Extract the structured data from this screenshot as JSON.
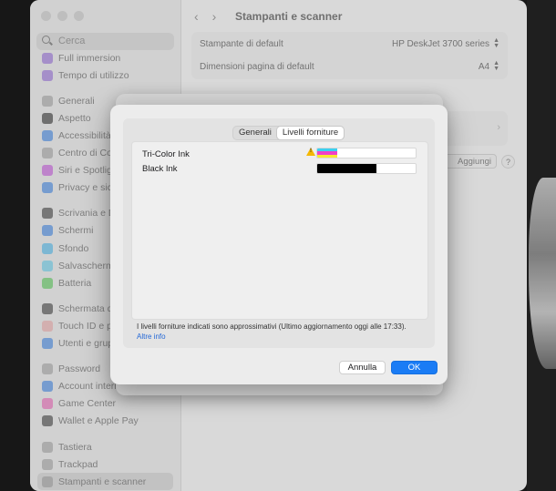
{
  "sidebar": {
    "search_placeholder": "Cerca",
    "items": [
      {
        "label": "Full immersion",
        "icon": "moon-icon",
        "color": "#8e62d6"
      },
      {
        "label": "Tempo di utilizzo",
        "icon": "hourglass-icon",
        "color": "#8e62d6"
      },
      {
        "label": "Generali",
        "icon": "gear-icon",
        "color": "#9a9a9a"
      },
      {
        "label": "Aspetto",
        "icon": "appearance-icon",
        "color": "#222222"
      },
      {
        "label": "Accessibilità",
        "icon": "accessibility-icon",
        "color": "#2f7be0"
      },
      {
        "label": "Centro di Cont",
        "icon": "control-center-icon",
        "color": "#9a9a9a"
      },
      {
        "label": "Siri e Spotlight",
        "icon": "siri-icon",
        "color": "#c04ad8"
      },
      {
        "label": "Privacy e sicur",
        "icon": "hand-icon",
        "color": "#2f7be0"
      },
      {
        "label": "Scrivania e Do",
        "icon": "dock-icon",
        "color": "#333333"
      },
      {
        "label": "Schermi",
        "icon": "display-icon",
        "color": "#2f7be0"
      },
      {
        "label": "Sfondo",
        "icon": "wallpaper-icon",
        "color": "#3eb0e8"
      },
      {
        "label": "Salvaschermo",
        "icon": "screensaver-icon",
        "color": "#5ac8e8"
      },
      {
        "label": "Batteria",
        "icon": "battery-icon",
        "color": "#4cc44c"
      },
      {
        "label": "Schermata di b",
        "icon": "lock-icon",
        "color": "#333333"
      },
      {
        "label": "Touch ID e pas",
        "icon": "fingerprint-icon",
        "color": "#e8a0a0"
      },
      {
        "label": "Utenti e grupp",
        "icon": "users-icon",
        "color": "#2f7be0"
      },
      {
        "label": "Password",
        "icon": "key-icon",
        "color": "#9a9a9a"
      },
      {
        "label": "Account intern",
        "icon": "at-icon",
        "color": "#2f7be0"
      },
      {
        "label": "Game Center",
        "icon": "game-center-icon",
        "color": "#e85ab0"
      },
      {
        "label": "Wallet e Apple Pay",
        "icon": "wallet-icon",
        "color": "#333333"
      },
      {
        "label": "Tastiera",
        "icon": "keyboard-icon",
        "color": "#9a9a9a"
      },
      {
        "label": "Trackpad",
        "icon": "trackpad-icon",
        "color": "#9a9a9a"
      },
      {
        "label": "Stampanti e scanner",
        "icon": "printer-icon",
        "color": "#9a9a9a"
      }
    ]
  },
  "main": {
    "title": "Stampanti e scanner",
    "default_printer_label": "Stampante di default",
    "default_printer_value": "HP DeskJet 3700 series",
    "page_size_label": "Dimensioni pagina di default",
    "page_size_value": "A4",
    "add_button": "Aggiungi stampante, scanner o fax...",
    "help_button": "?"
  },
  "dialog": {
    "tabs": [
      "Generali",
      "Livelli forniture"
    ],
    "active_tab": "Livelli forniture",
    "inks": [
      {
        "name": "Tri-Color Ink",
        "level": 0.2,
        "warning": true,
        "colors": [
          "#3ad0f0",
          "#f040c8",
          "#f8e830"
        ]
      },
      {
        "name": "Black Ink",
        "level": 0.6,
        "warning": false,
        "colors": [
          "#000000"
        ]
      }
    ],
    "footnote": "I livelli forniture indicati sono approssimativi (Ultimo aggiornamento oggi alle 17:33).",
    "more_info": "Altre info",
    "cancel": "Annulla",
    "ok": "OK"
  }
}
